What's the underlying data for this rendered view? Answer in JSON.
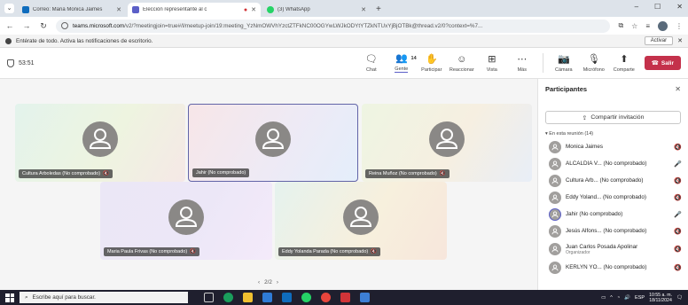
{
  "browser": {
    "tabs": [
      {
        "label": "Correo: Maria Monica Jaimes",
        "active": false,
        "color": "#0f6cbd"
      },
      {
        "label": "Elección representante al c",
        "active": true,
        "color": "#5b5fc7"
      },
      {
        "label": "(3) WhatsApp",
        "active": false,
        "color": "#25d366"
      }
    ],
    "url_host": "teams.microsoft.com",
    "url_path": "/v2/?meetingjoin=true#/l/meetup-join/19:meeting_YzNmOWVhYzctZTFkNC00OGYwLWJkODYtYTZkNTUxYjBjOTBk@thread.v2/0?context=%7..."
  },
  "notification": {
    "text": "Entérate de todo. Activa las notificaciones de escritorio.",
    "button": "Activar"
  },
  "meeting": {
    "timer": "53:51",
    "controls": {
      "chat": "Chat",
      "people": "Gente",
      "people_count": "14",
      "raise": "Participar",
      "react": "Reaccionar",
      "view": "Vista",
      "more": "Más",
      "camera": "Cámara",
      "mic": "Micrófono",
      "share": "Comparte",
      "leave": "Salir"
    },
    "tiles": [
      "Cultura Arboledas (No comprobado)",
      "Jahir (No comprobado)",
      "Reina Muñoz (No comprobado)",
      "Maria Paula Frivas (No comprobado)",
      "Eddy Yolanda Parada (No comprobado)"
    ],
    "pager": "2/2"
  },
  "participants": {
    "title": "Participantes",
    "invite": "Compartir invitación",
    "section": "En esta reunión (14)",
    "list": [
      {
        "name": "Monica Jaimes",
        "sub": "",
        "mic": "🔇"
      },
      {
        "name": "ALCALDIA V... (No comprobado)",
        "sub": "",
        "mic": "🎤"
      },
      {
        "name": "Cultura Arb... (No comprobado)",
        "sub": "",
        "mic": "🔇"
      },
      {
        "name": "Eddy Yoland... (No comprobado)",
        "sub": "",
        "mic": "🔇"
      },
      {
        "name": "Jahir (No comprobado)",
        "sub": "",
        "mic": "🎤"
      },
      {
        "name": "Jesús Alfons... (No comprobado)",
        "sub": "",
        "mic": "🔇"
      },
      {
        "name": "Juan Carlos Posada Apolinar",
        "sub": "Organizador",
        "mic": "🔇"
      },
      {
        "name": "KERLYN YO... (No comprobado)",
        "sub": "",
        "mic": "🔇"
      }
    ]
  },
  "taskbar": {
    "search": "Escribe aquí para buscar.",
    "lang": "ESP",
    "time": "10:55 a. m.",
    "date": "18/11/2024"
  }
}
